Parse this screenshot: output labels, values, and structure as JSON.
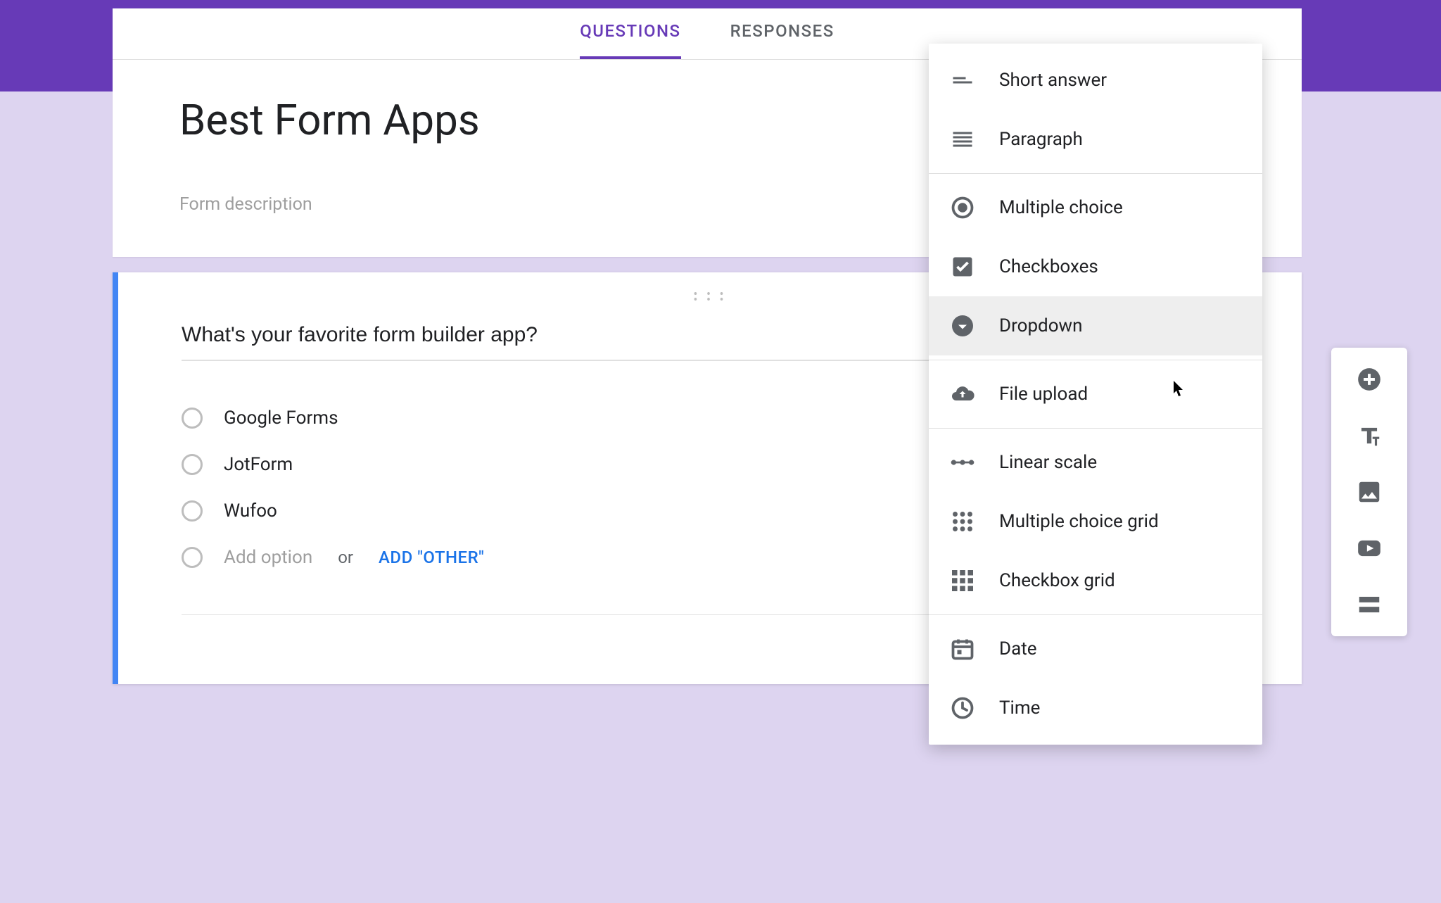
{
  "tabs": {
    "questions": "QUESTIONS",
    "responses": "RESPONSES",
    "active": "questions"
  },
  "form": {
    "title": "Best Form Apps",
    "description_placeholder": "Form description"
  },
  "question": {
    "text": "What's your favorite form builder app?",
    "options": [
      "Google Forms",
      "JotForm",
      "Wufoo"
    ],
    "add_option_label": "Add option",
    "or_label": "or",
    "add_other_label": "ADD \"OTHER\""
  },
  "type_menu": {
    "hovered": "dropdown",
    "items": [
      {
        "id": "short_answer",
        "label": "Short answer",
        "icon": "short-answer-icon"
      },
      {
        "id": "paragraph",
        "label": "Paragraph",
        "icon": "paragraph-icon"
      },
      {
        "sep": true
      },
      {
        "id": "multiple_choice",
        "label": "Multiple choice",
        "icon": "radio-icon"
      },
      {
        "id": "checkboxes",
        "label": "Checkboxes",
        "icon": "checkbox-icon"
      },
      {
        "id": "dropdown",
        "label": "Dropdown",
        "icon": "dropdown-icon"
      },
      {
        "sep": true
      },
      {
        "id": "file_upload",
        "label": "File upload",
        "icon": "cloud-upload-icon"
      },
      {
        "sep": true
      },
      {
        "id": "linear_scale",
        "label": "Linear scale",
        "icon": "linear-scale-icon"
      },
      {
        "id": "mc_grid",
        "label": "Multiple choice grid",
        "icon": "grid-dots-icon"
      },
      {
        "id": "cb_grid",
        "label": "Checkbox grid",
        "icon": "grid-squares-icon"
      },
      {
        "sep": true
      },
      {
        "id": "date",
        "label": "Date",
        "icon": "calendar-icon"
      },
      {
        "id": "time",
        "label": "Time",
        "icon": "clock-icon"
      }
    ]
  },
  "side_toolbar": {
    "add_question": "add-question",
    "add_title": "add-title-desc",
    "add_image": "add-image",
    "add_video": "add-video",
    "add_section": "add-section"
  }
}
